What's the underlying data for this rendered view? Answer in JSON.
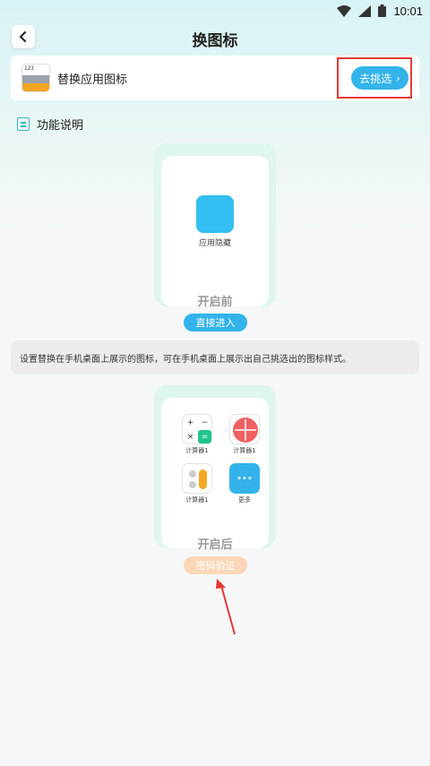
{
  "status_bar": {
    "time": "10:01",
    "icons": [
      "wifi-icon",
      "signal-icon",
      "battery-icon"
    ]
  },
  "nav": {
    "title": "换图标",
    "back_icon": "chevron-left-icon"
  },
  "replace_card": {
    "label": "替换应用图标",
    "icon_text": "123",
    "button_label": "去挑选",
    "button_chevron": "›"
  },
  "section": {
    "title": "功能说明",
    "icon": "document-icon"
  },
  "before": {
    "app_label": "应用隐藏",
    "state_label": "开启前",
    "button_label": "直接进入"
  },
  "description": "设置替换在手机桌面上展示的图标，可在手机桌面上展示出自己挑选出的图标样式。",
  "after": {
    "apps": [
      {
        "label": "计算器1",
        "icon": "calculator-icon"
      },
      {
        "label": "计算器1",
        "icon": "calculator-round-icon"
      },
      {
        "label": "计算器1",
        "icon": "calculator-toggle-icon"
      },
      {
        "label": "更多",
        "icon": "more-icon"
      }
    ],
    "more_text": "•••",
    "state_label": "开启后",
    "button_label": "密码验证"
  },
  "colors": {
    "accent": "#33b3ea",
    "highlight": "#e53935",
    "pill_disabled": "#fbd7b8",
    "frame_bg": "#dff5ef"
  }
}
